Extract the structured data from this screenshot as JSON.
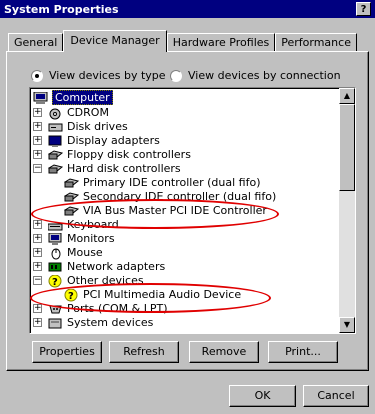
{
  "window": {
    "title": "System Properties",
    "help_label": "?"
  },
  "tabs": [
    "General",
    "Device Manager",
    "Hardware Profiles",
    "Performance"
  ],
  "view": {
    "by_type": "View devices by type",
    "by_connection": "View devices by connection",
    "selected": "by_type"
  },
  "tree": [
    {
      "label": "Computer",
      "icon": "computer-icon"
    },
    {
      "label": "CDROM",
      "icon": "cdrom-icon"
    },
    {
      "label": "Disk drives",
      "icon": "disk-drive-icon"
    },
    {
      "label": "Display adapters",
      "icon": "display-adapter-icon"
    },
    {
      "label": "Floppy disk controllers",
      "icon": "controller-icon"
    },
    {
      "label": "Hard disk controllers",
      "icon": "controller-icon"
    },
    {
      "label": "Primary IDE controller (dual fifo)",
      "icon": "controller-icon"
    },
    {
      "label": "Secondary IDE controller (dual fifo)",
      "icon": "controller-icon"
    },
    {
      "label": "VIA Bus Master PCI IDE Controller",
      "icon": "controller-icon"
    },
    {
      "label": "Keyboard",
      "icon": "keyboard-icon"
    },
    {
      "label": "Monitors",
      "icon": "monitor-icon"
    },
    {
      "label": "Mouse",
      "icon": "mouse-icon"
    },
    {
      "label": "Network adapters",
      "icon": "network-icon"
    },
    {
      "label": "Other devices",
      "icon": "warning-question-icon"
    },
    {
      "label": "PCI Multimedia Audio Device",
      "icon": "warning-question-icon"
    },
    {
      "label": "Ports (COM & LPT)",
      "icon": "port-icon"
    },
    {
      "label": "System devices",
      "icon": "system-icon"
    }
  ],
  "buttons": {
    "properties": "Properties",
    "refresh": "Refresh",
    "remove": "Remove",
    "print": "Print...",
    "ok": "OK",
    "cancel": "Cancel"
  },
  "colors": {
    "titlebar": "#000080",
    "annotation": "#e00000",
    "selection": "#000080"
  }
}
